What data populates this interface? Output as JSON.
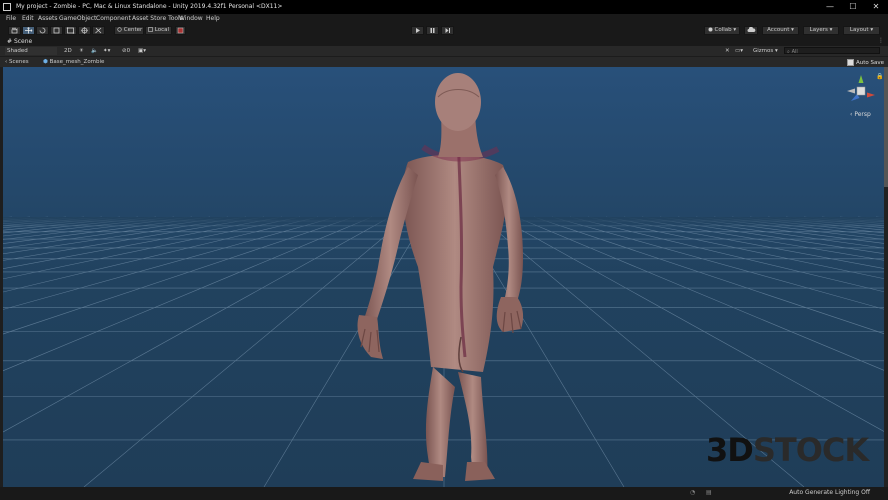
{
  "window": {
    "title": "My project - Zombie - PC, Mac & Linux Standalone - Unity 2019.4.32f1 Personal <DX11>",
    "minimize_glyph": "—",
    "maximize_glyph": "☐",
    "close_glyph": "✕"
  },
  "menu": [
    "File",
    "Edit",
    "Assets",
    "GameObject",
    "Component",
    "Asset Store Tools",
    "Window",
    "Help"
  ],
  "toolbar": {
    "tool_icons": [
      "hand-tool-icon",
      "move-tool-icon",
      "rotate-tool-icon",
      "scale-tool-icon",
      "rect-tool-icon",
      "transform-tool-icon",
      "custom-tool-icon"
    ],
    "pivot_label": "Center",
    "space_label": "Local",
    "collab_label": "Collab ▾",
    "account_label": "Account ▾",
    "layers_label": "Layers ▾",
    "layout_label": "Layout ▾"
  },
  "scene_tab": {
    "label": "Scene"
  },
  "scene_bar": {
    "draw_mode": "Shaded",
    "mode_2d": "2D",
    "hidden_count": "0",
    "gizmos_label": "Gizmos ▾",
    "search_placeholder": "All"
  },
  "breadcrumb": {
    "scenes_label": "Scenes",
    "object_name": "Base_mesh_Zombie",
    "auto_save_label": "Auto Save",
    "auto_save_checked": true
  },
  "gizmo": {
    "projection_label": "Persp"
  },
  "status": {
    "message": "Auto Generate Lighting Off"
  },
  "watermark": {
    "part1": "3D",
    "part2": "STOCK"
  },
  "colors": {
    "viewport_bg": "#21425f",
    "grid_line": "#6e8ba5",
    "skin": "#a77b74",
    "editor_bg": "#191919"
  }
}
